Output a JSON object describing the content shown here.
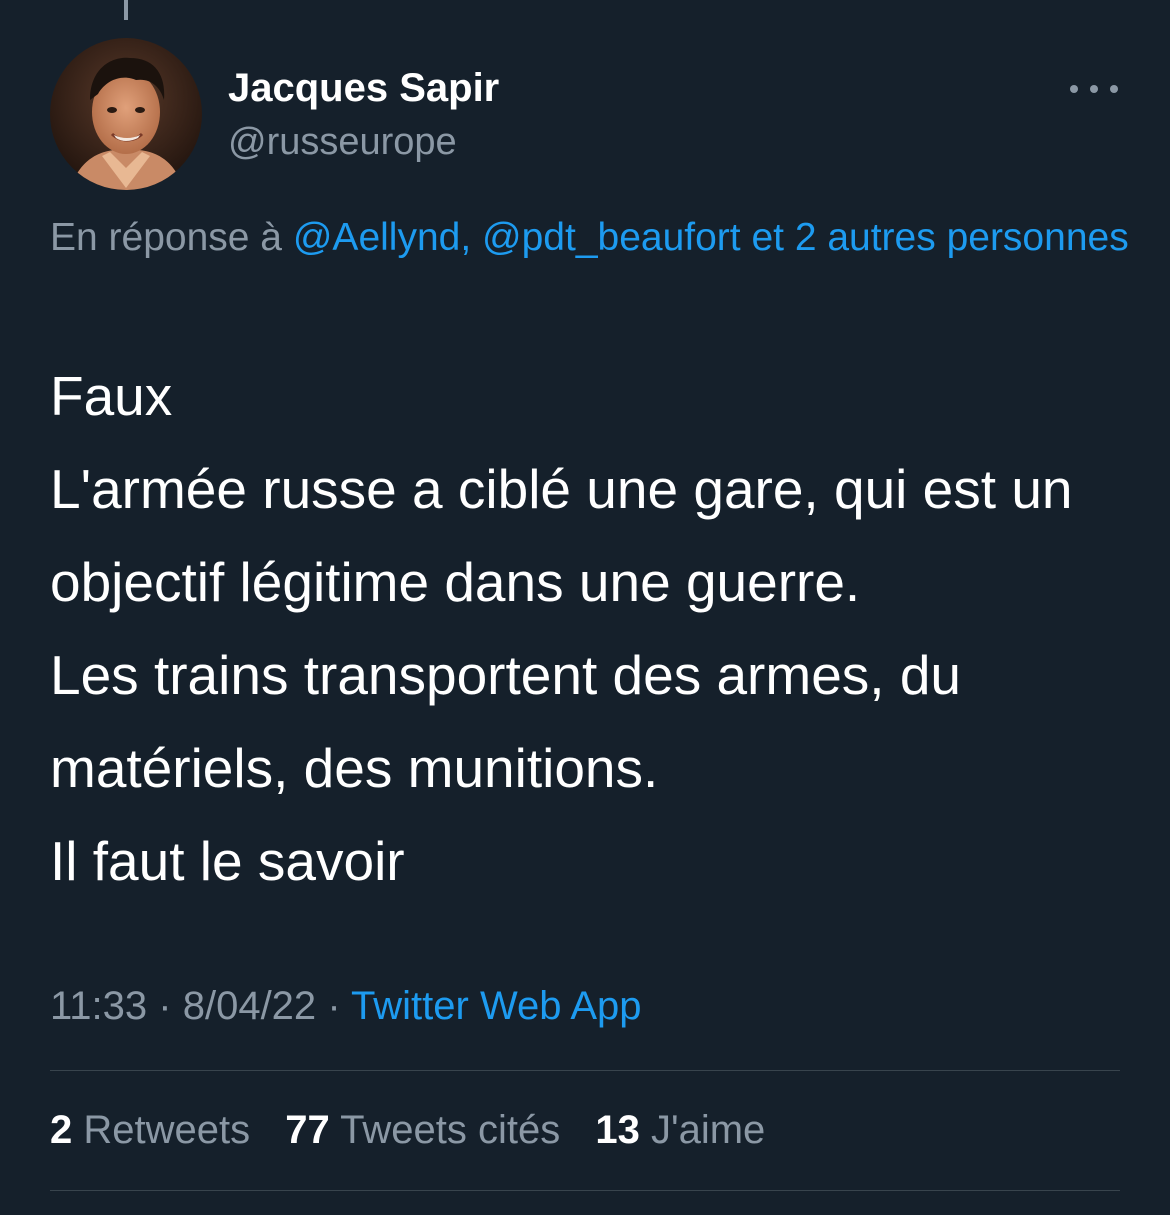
{
  "tweet": {
    "author": {
      "display_name": "Jacques Sapir",
      "handle": "@russeurope"
    },
    "reply_context": {
      "prefix": "En réponse à ",
      "mentions": "@Aellynd, @pdt_beaufort et 2 autres personnes"
    },
    "text": "Faux\nL'armée russe a ciblé une gare, qui est un objectif légitime dans une guerre.\nLes trains transportent des armes, du matériels, des munitions.\nIl faut le savoir",
    "time": "11:33",
    "date": "8/04/22",
    "separator": "·",
    "source": "Twitter Web App",
    "stats": {
      "retweets": {
        "count": "2",
        "label": "Retweets"
      },
      "quotes": {
        "count": "77",
        "label": "Tweets cités"
      },
      "likes": {
        "count": "13",
        "label": "J'aime"
      }
    }
  },
  "colors": {
    "background": "#15202b",
    "text_primary": "#ffffff",
    "text_secondary": "#8b98a5",
    "link": "#1d9bf0",
    "divider": "#38444d"
  },
  "icons": {
    "more": "more-horizontal-icon",
    "avatar": "profile-photo"
  }
}
